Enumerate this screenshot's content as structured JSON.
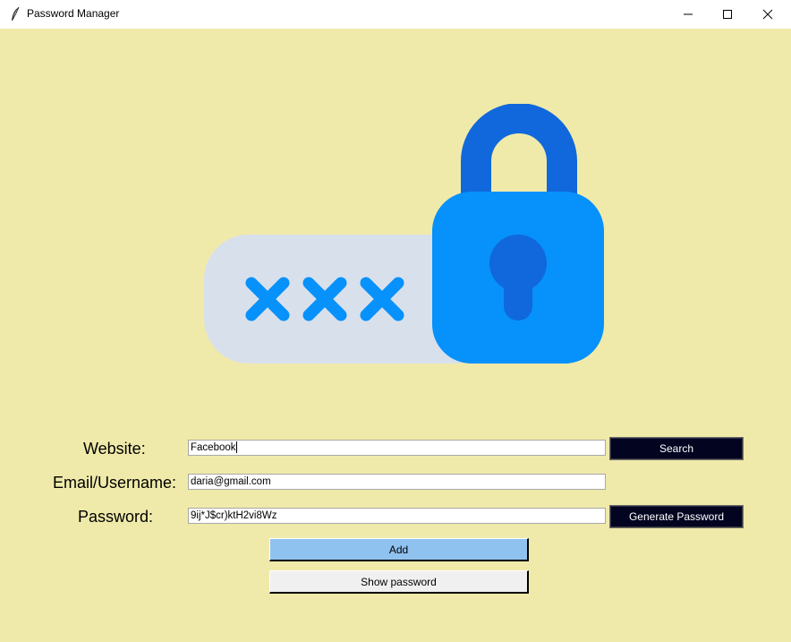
{
  "window": {
    "title": "Password Manager",
    "icon": "feather-icon",
    "controls": [
      "minimize-icon",
      "maximize-icon",
      "close-icon"
    ]
  },
  "logo": {
    "icon": "password-lock-icon"
  },
  "form": {
    "website_label": "Website:",
    "website_value": "Facebook",
    "email_label": "Email/Username:",
    "email_value": "daria@gmail.com",
    "password_label": "Password:",
    "password_value": "9ij*J$cr)ktH2vi8Wz"
  },
  "buttons": {
    "search": "Search",
    "generate_password": "Generate Password",
    "add": "Add",
    "show_password": "Show password"
  },
  "colors": {
    "background": "#f0eaaa",
    "dark_button": "#020420",
    "add_button": "#90c2ef",
    "show_button": "#f0f0f0",
    "lock_body": "#0791fb",
    "lock_shackle": "#1068dc",
    "field_bg": "#d8e0ec"
  }
}
